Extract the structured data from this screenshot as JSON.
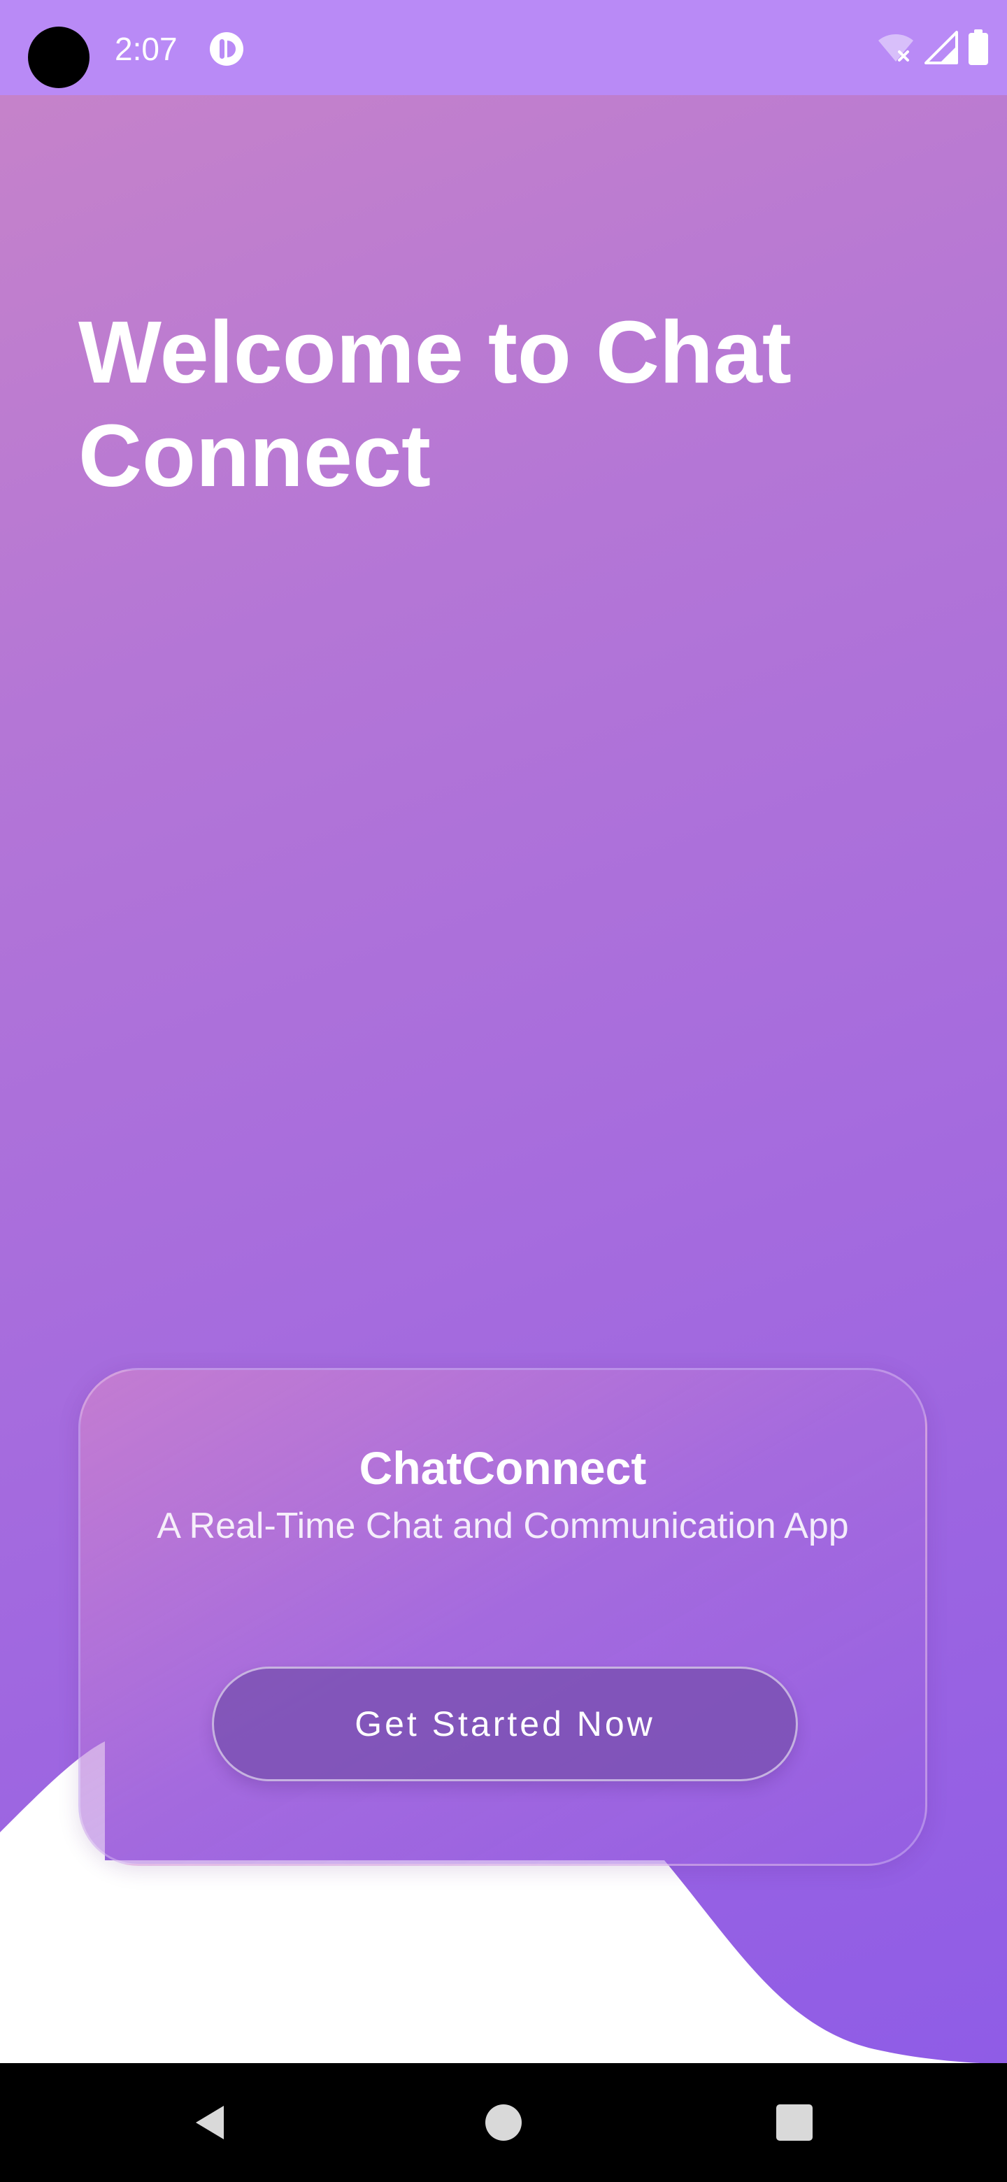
{
  "status_bar": {
    "time": "2:07",
    "icons": [
      "camera-hole",
      "app-notification-icon",
      "wifi-off-icon",
      "cell-signal-icon",
      "battery-icon"
    ]
  },
  "main": {
    "title": "Welcome to Chat Connect"
  },
  "card": {
    "title": "ChatConnect",
    "subtitle": "A Real-Time Chat and Communication App",
    "button_label": "Get Started Now"
  },
  "nav_bar": {
    "icons": [
      "back-icon",
      "home-icon",
      "recents-icon"
    ]
  },
  "colors": {
    "status_bar": "#b98af6",
    "gradient_start": "#c884c8",
    "gradient_end": "#8f5ce6",
    "button": "#7c52b4",
    "text": "#ffffff"
  }
}
